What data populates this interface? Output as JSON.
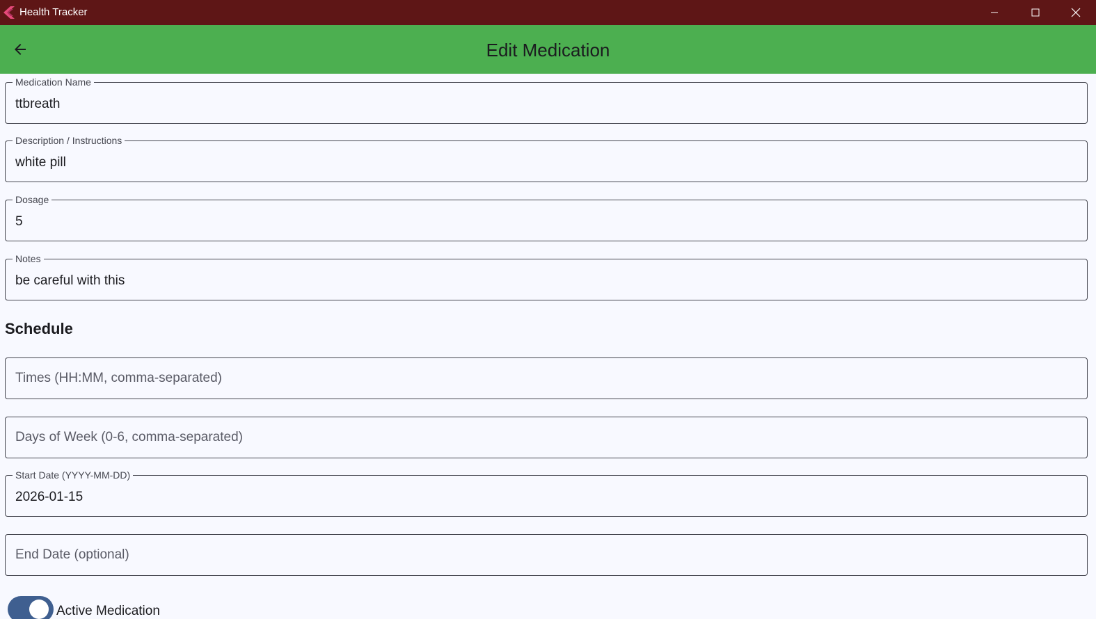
{
  "window": {
    "title": "Health Tracker",
    "controls": {
      "minimize_icon": "minimize-icon",
      "maximize_icon": "maximize-icon",
      "close_icon": "close-icon"
    }
  },
  "appbar": {
    "title": "Edit Medication",
    "back_icon": "arrow-back-icon",
    "color": "#4caf50"
  },
  "form": {
    "medication_name": {
      "label": "Medication Name",
      "value": "ttbreath"
    },
    "description": {
      "label": "Description / Instructions",
      "value": "white pill"
    },
    "dosage": {
      "label": "Dosage",
      "value": "5"
    },
    "notes": {
      "label": "Notes",
      "value": "be careful with this"
    }
  },
  "schedule": {
    "title": "Schedule",
    "times": {
      "placeholder": "Times (HH:MM, comma-separated)",
      "value": ""
    },
    "days_of_week": {
      "placeholder": "Days of Week (0-6, comma-separated)",
      "value": ""
    },
    "start_date": {
      "label": "Start Date (YYYY-MM-DD)",
      "value": "2026-01-15"
    },
    "end_date": {
      "placeholder": "End Date (optional)",
      "value": ""
    }
  },
  "active_toggle": {
    "label": "Active Medication",
    "on": true,
    "color": "#3f5f90"
  },
  "colors": {
    "titlebar": "#5e1616",
    "background": "#f8f9ff",
    "border": "#45464f"
  }
}
